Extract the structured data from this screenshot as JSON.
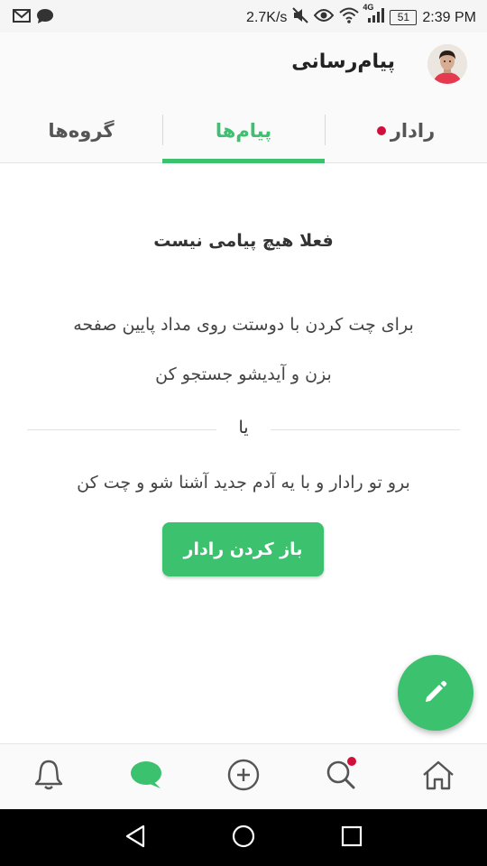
{
  "status_bar": {
    "network_speed": "2.7K/s",
    "network_type": "4G",
    "battery": "51",
    "time": "2:39 PM",
    "icons_left": [
      "gmail-icon",
      "message-icon"
    ],
    "icons_right": [
      "mute-icon",
      "eye-icon",
      "wifi-icon",
      "signal-icon",
      "battery-icon"
    ]
  },
  "header": {
    "title": "پیام‌رسانی",
    "avatar": "avatar"
  },
  "tabs": [
    {
      "label": "گروه‌ها",
      "active": false
    },
    {
      "label": "پیام‌ها",
      "active": true
    },
    {
      "label": "رادار",
      "active": false,
      "has_dot": true
    }
  ],
  "empty_state": {
    "title": "فعلا هیچ پیامی نیست",
    "line1": "برای چت کردن با دوستت روی مداد پایین صفحه",
    "line2": "بزن و آیدیشو جستجو کن",
    "or": "یا",
    "line3": "برو تو رادار و با یه آدم جدید آشنا شو و چت کن",
    "button_label": "باز کردن رادار"
  },
  "fab": {
    "icon": "pencil-icon"
  },
  "bottom_nav": [
    {
      "icon": "home-icon",
      "active": false
    },
    {
      "icon": "search-icon",
      "active": false,
      "has_dot": true
    },
    {
      "icon": "add-circle-icon",
      "active": false
    },
    {
      "icon": "chat-icon",
      "active": true
    },
    {
      "icon": "bell-icon",
      "active": false
    }
  ],
  "system_nav": [
    "back-icon",
    "home-circle-icon",
    "recents-icon"
  ],
  "colors": {
    "accent": "#3cc16f",
    "badge": "#d0103a",
    "icon_gray": "#555555",
    "header_bg": "#fafafa"
  }
}
